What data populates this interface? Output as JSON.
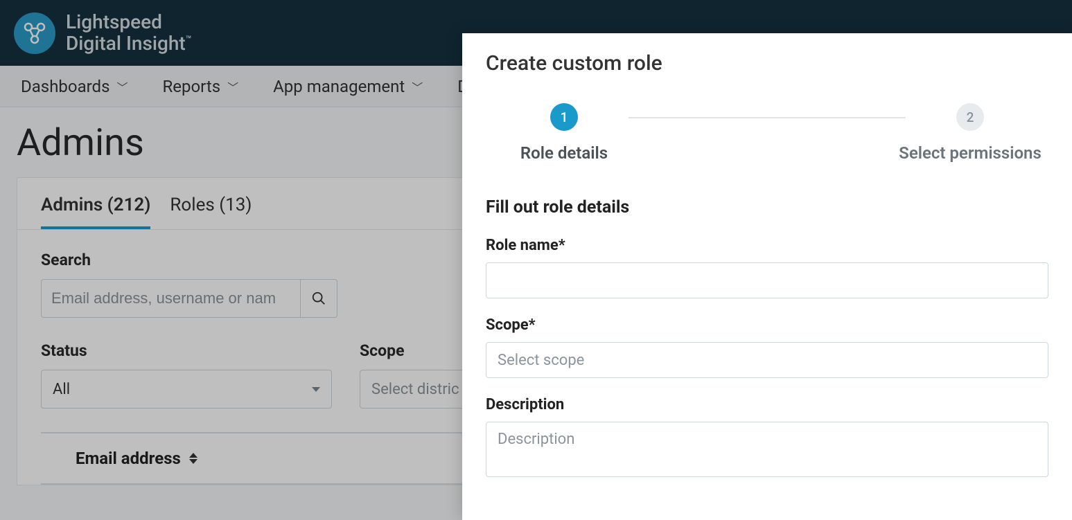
{
  "brand": {
    "line1": "Lightspeed",
    "line2": "Digital Insight",
    "tm": "™"
  },
  "nav": {
    "items": [
      {
        "label": "Dashboards"
      },
      {
        "label": "Reports"
      },
      {
        "label": "App management"
      }
    ],
    "partial": "D"
  },
  "page": {
    "title": "Admins"
  },
  "tabs": {
    "items": [
      {
        "label": "Admins (212)",
        "active": true
      },
      {
        "label": "Roles (13)",
        "active": false
      }
    ]
  },
  "filters": {
    "search_label": "Search",
    "search_placeholder": "Email address, username or nam",
    "status_label": "Status",
    "status_value": "All",
    "scope_label": "Scope",
    "scope_placeholder": "Select distric"
  },
  "table": {
    "columns": [
      {
        "label": "Email address"
      }
    ]
  },
  "panel": {
    "title": "Create custom role",
    "steps": [
      {
        "num": "1",
        "label": "Role details",
        "active": true
      },
      {
        "num": "2",
        "label": "Select permissions",
        "active": false
      }
    ],
    "section_title": "Fill out role details",
    "fields": {
      "role_name_label": "Role name*",
      "role_name_value": "",
      "scope_label": "Scope*",
      "scope_placeholder": "Select scope",
      "description_label": "Description",
      "description_placeholder": "Description"
    }
  }
}
